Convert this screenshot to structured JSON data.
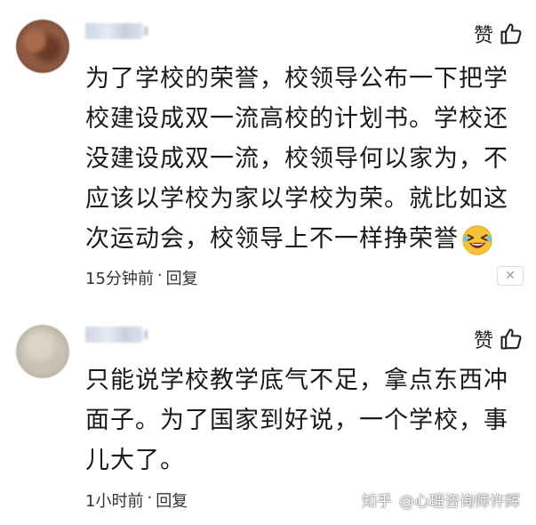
{
  "comments": [
    {
      "like_label": "赞",
      "lines": [
        "为了学校的荣誉，校领导公布一下把学",
        "校建设成双一流高校的计划书。学校还",
        "没建设成双一流，校领导何以家为，不",
        "应该以学校为家以学校为荣。就比如这",
        "次运动会，校领导上不一样挣荣誉"
      ],
      "emoji": "laughing-squint-emoji",
      "time": "15分钟前",
      "separator": "·",
      "reply_label": "回复",
      "close_symbol": "✕"
    },
    {
      "like_label": "赞",
      "lines": [
        "只能说学校教学底气不足，拿点东西冲",
        "面子。为了国家到好说，一个学校，事",
        "儿大了。"
      ],
      "time": "1小时前",
      "separator": "·",
      "reply_label": "回复"
    }
  ],
  "watermark": {
    "site": "知乎",
    "author": "@心理咨询师许辉"
  },
  "colors": {
    "text": "#1a1a1a",
    "meta": "#333333",
    "emoji_face": "#f5c23a"
  }
}
